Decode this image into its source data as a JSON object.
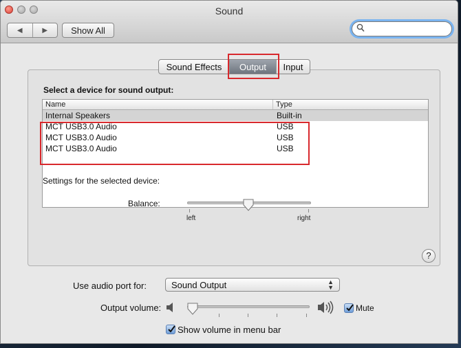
{
  "window": {
    "title": "Sound"
  },
  "toolbar": {
    "show_all_label": "Show All",
    "back_glyph": "◀",
    "forward_glyph": "▶",
    "search_value": ""
  },
  "tabs": [
    {
      "label": "Sound Effects"
    },
    {
      "label": "Output",
      "selected": true
    },
    {
      "label": "Input"
    }
  ],
  "output": {
    "section_title": "Select a device for sound output:",
    "columns": {
      "name": "Name",
      "type": "Type"
    },
    "devices": [
      {
        "name": "Internal Speakers",
        "type": "Built-in",
        "selected": true
      },
      {
        "name": "MCT USB3.0 Audio",
        "type": "USB"
      },
      {
        "name": "MCT USB3.0 Audio",
        "type": "USB"
      },
      {
        "name": "MCT USB3.0 Audio",
        "type": "USB"
      }
    ],
    "settings_label": "Settings for the selected device:",
    "balance": {
      "label": "Balance:",
      "left_label": "left",
      "right_label": "right",
      "value": 0.5
    }
  },
  "bottom": {
    "port_label": "Use audio port for:",
    "port_value": "Sound Output",
    "volume_label": "Output volume:",
    "volume_value": 0.05,
    "mute_label": "Mute",
    "mute_checked": true,
    "menubar_label": "Show volume in menu bar",
    "menubar_checked": true
  },
  "icons": {
    "search": "magnifier-icon",
    "help": "help-icon",
    "speaker_low": "speaker-low-icon",
    "speaker_high": "speaker-high-icon"
  },
  "colors": {
    "highlight": "#d8282c",
    "selected_tab": "#7b828b",
    "focus_ring": "#7ab4f0"
  },
  "help_glyph": "?"
}
